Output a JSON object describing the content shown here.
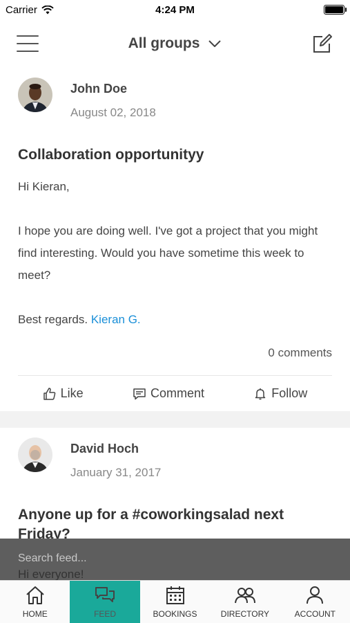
{
  "status_bar": {
    "carrier": "Carrier",
    "time": "4:24 PM"
  },
  "header": {
    "group_label": "All groups"
  },
  "posts": [
    {
      "author": "John Doe",
      "date": "August 02, 2018",
      "title": "Collaboration opportunityy",
      "greeting": "Hi Kieran,",
      "body": "I hope you are doing well. I've got a project that you might find interesting. Would you have sometime this week to meet?",
      "signoff": "Best regards.",
      "mention": "Kieran G.",
      "comments": "0 comments"
    },
    {
      "author": "David Hoch",
      "date": "January 31, 2017",
      "title": "Anyone up for a #coworkingsalad next Friday?",
      "greeting": "Hi everyone!"
    }
  ],
  "actions": {
    "like": "Like",
    "comment": "Comment",
    "follow": "Follow"
  },
  "search": {
    "placeholder": "Search feed..."
  },
  "tabs": [
    {
      "label": "HOME",
      "icon": "home-icon"
    },
    {
      "label": "FEED",
      "icon": "feed-icon",
      "active": true
    },
    {
      "label": "BOOKINGS",
      "icon": "calendar-icon"
    },
    {
      "label": "DIRECTORY",
      "icon": "people-icon"
    },
    {
      "label": "ACCOUNT",
      "icon": "user-icon"
    }
  ],
  "colors": {
    "accent": "#1aa99a",
    "mention": "#1a8fd8"
  }
}
